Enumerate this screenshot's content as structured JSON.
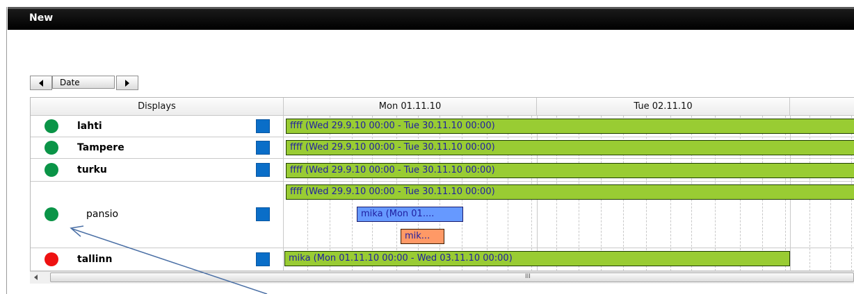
{
  "window": {
    "title": "New"
  },
  "nav": {
    "prev_icon": "triangle-left",
    "date_label": "Date",
    "next_icon": "triangle-right"
  },
  "header": {
    "displays": "Displays",
    "day1": "Mon 01.11.10",
    "day2": "Tue 02.11.10"
  },
  "rows": [
    {
      "name": "lahti",
      "status": "online",
      "status_color": "#0a9447",
      "events": [
        {
          "label": "ffff (Wed 29.9.10 00:00 - Tue 30.11.10 00:00)",
          "color": "#99cc33"
        }
      ]
    },
    {
      "name": "Tampere",
      "status": "online",
      "status_color": "#0a9447",
      "events": [
        {
          "label": "ffff (Wed 29.9.10 00:00 - Tue 30.11.10 00:00)",
          "color": "#99cc33"
        }
      ]
    },
    {
      "name": "turku",
      "status": "online",
      "status_color": "#0a9447",
      "events": [
        {
          "label": "ffff (Wed 29.9.10 00:00 - Tue 30.11.10 00:00)",
          "color": "#99cc33"
        }
      ]
    },
    {
      "name": "pansio",
      "status": "online",
      "status_color": "#0a9447",
      "events": [
        {
          "label": "ffff (Wed 29.9.10 00:00 - Tue 30.11.10 00:00)",
          "color": "#99cc33"
        },
        {
          "label": "mika (Mon 01....",
          "color": "#6699ff"
        },
        {
          "label": "mik...",
          "color": "#ff9966"
        }
      ]
    },
    {
      "name": "tallinn",
      "status": "offline",
      "status_color": "#ee1111",
      "events": [
        {
          "label": "mika (Mon 01.11.10 00:00 - Wed 03.11.10 00:00)",
          "color": "#99cc33"
        }
      ]
    }
  ],
  "scrollbar": {
    "grip": "III"
  },
  "colors": {
    "accent_blue": "#0a6ec8",
    "event_green": "#99cc33",
    "event_blue": "#6699ff",
    "event_orange": "#ff9966"
  }
}
